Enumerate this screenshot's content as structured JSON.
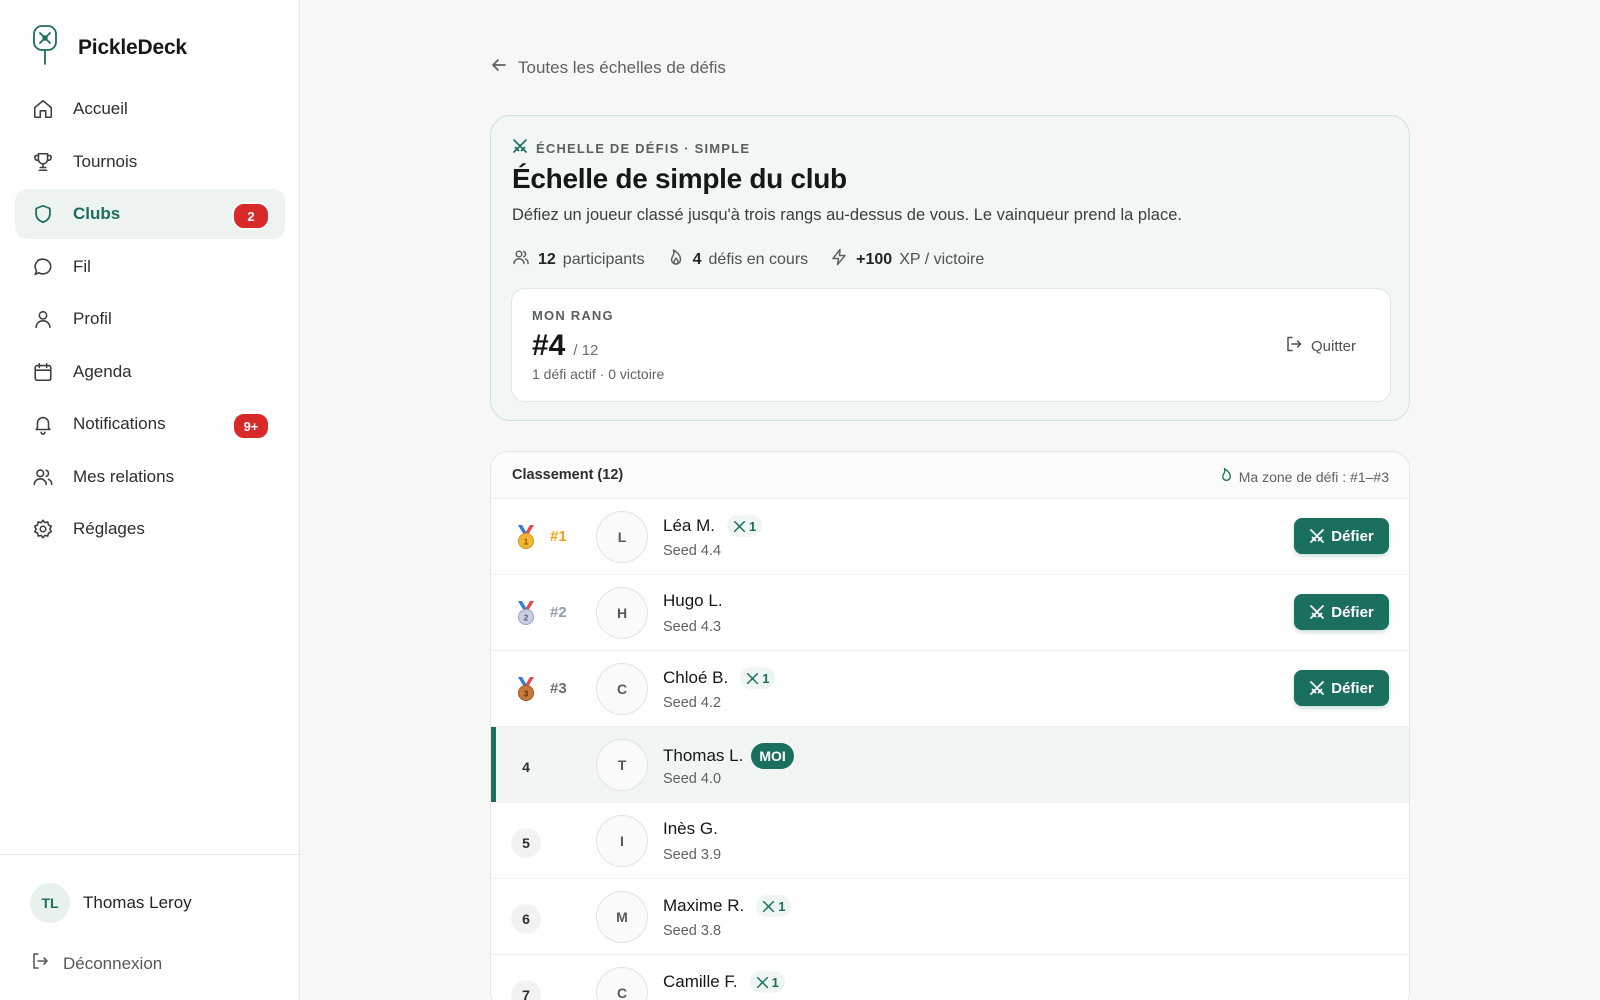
{
  "app": {
    "name": "PickleDeck"
  },
  "colors": {
    "accent": "#1b6f5f",
    "badge": "#d92a2a",
    "gold": "#e8a317",
    "silver": "#8f9bb0",
    "bronze": "#b5651d"
  },
  "sidebar": {
    "items": [
      {
        "label": "Accueil",
        "icon": "home-icon"
      },
      {
        "label": "Tournois",
        "icon": "trophy-icon"
      },
      {
        "label": "Clubs",
        "icon": "shield-icon",
        "badge": "2",
        "active": true
      },
      {
        "label": "Fil",
        "icon": "chat-bubble-icon"
      },
      {
        "label": "Profil",
        "icon": "user-icon"
      },
      {
        "label": "Agenda",
        "icon": "calendar-icon"
      },
      {
        "label": "Notifications",
        "icon": "bell-icon",
        "badge": "9+"
      },
      {
        "label": "Mes relations",
        "icon": "users-icon"
      },
      {
        "label": "Réglages",
        "icon": "gear-icon"
      }
    ],
    "user": {
      "initials": "TL",
      "name": "Thomas Leroy"
    },
    "logout_label": "Déconnexion"
  },
  "back_link": "Toutes les échelles de défis",
  "ladder": {
    "eyebrow": "ÉCHELLE DE DÉFIS · SIMPLE",
    "title": "Échelle de simple du club",
    "description": "Défiez un joueur classé jusqu'à trois rangs au-dessus de vous. Le vainqueur prend la place.",
    "stats": {
      "participants_count": "12",
      "participants_label": "participants",
      "challenges_count": "4",
      "challenges_label": "défis en cours",
      "xp_value": "+100",
      "xp_label": "XP / victoire"
    },
    "my_rank": {
      "eyebrow": "MON RANG",
      "value": "#4",
      "total": "/ 12",
      "sub": "1 défi actif · 0 victoire",
      "quit_label": "Quitter"
    }
  },
  "ranking": {
    "title": "Classement (12)",
    "zone": "Ma zone de défi : #1–#3",
    "challenge_label": "Défier",
    "me_tag": "MOI",
    "rows": [
      {
        "rank": "#1",
        "medal": "gold",
        "medal_num": "1",
        "initial": "L",
        "name": "Léa M.",
        "wins": "1",
        "seed": "Seed 4.4",
        "challenge": true
      },
      {
        "rank": "#2",
        "medal": "silver",
        "medal_num": "2",
        "initial": "H",
        "name": "Hugo L.",
        "seed": "Seed 4.3",
        "challenge": true
      },
      {
        "rank": "#3",
        "medal": "bronze",
        "medal_num": "3",
        "initial": "C",
        "name": "Chloé B.",
        "wins": "1",
        "seed": "Seed 4.2",
        "challenge": true
      },
      {
        "rank": "4",
        "initial": "T",
        "name": "Thomas L.",
        "seed": "Seed 4.0",
        "me": true
      },
      {
        "rank": "5",
        "initial": "I",
        "name": "Inès G.",
        "seed": "Seed 3.9"
      },
      {
        "rank": "6",
        "initial": "M",
        "name": "Maxime R.",
        "wins": "1",
        "seed": "Seed 3.8"
      },
      {
        "rank": "7",
        "initial": "C",
        "name": "Camille F.",
        "wins": "1",
        "seed": ""
      }
    ]
  }
}
